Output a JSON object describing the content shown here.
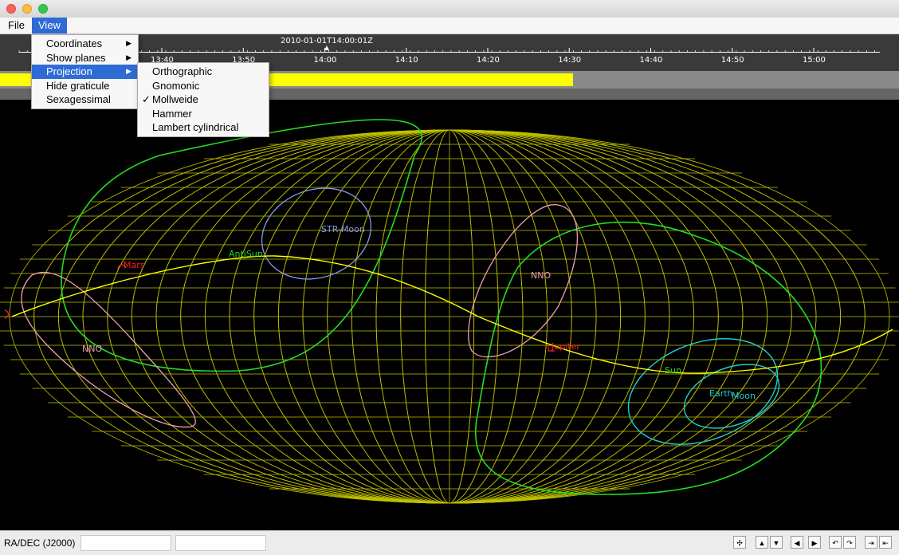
{
  "menu": {
    "file_label": "File",
    "view_label": "View"
  },
  "view_menu": {
    "items": [
      {
        "label": "Coordinates",
        "submenu": true
      },
      {
        "label": "Show planes",
        "submenu": true
      },
      {
        "label": "Projection",
        "submenu": true,
        "highlighted": true
      },
      {
        "label": "Hide graticule",
        "submenu": false
      },
      {
        "label": "Sexagessimal",
        "submenu": false
      }
    ]
  },
  "projection_menu": {
    "items": [
      {
        "label": "Orthographic",
        "checked": false
      },
      {
        "label": "Gnomonic",
        "checked": false
      },
      {
        "label": "Mollweide",
        "checked": true
      },
      {
        "label": "Hammer",
        "checked": false
      },
      {
        "label": "Lambert cylindrical",
        "checked": false
      }
    ],
    "check_mark": "✓"
  },
  "timeline": {
    "current_time": "2010-01-01T14:00:01Z",
    "ticks": [
      "13:40",
      "13:50",
      "14:00",
      "14:10",
      "14:20",
      "14:30",
      "14:40",
      "14:50",
      "15:00"
    ],
    "progress_fraction": 0.637
  },
  "sky_labels": {
    "str_moon": "STR-Moon",
    "antisun": "AntiSun",
    "mars": "Mars",
    "nno_left": "NNO",
    "nno_right": "NNO",
    "jupiter": "Jupiter",
    "sun": "Sun",
    "earth": "Earth",
    "moon": "Moon"
  },
  "status": {
    "coord_label": "RA/DEC (J2000)",
    "field1_value": "",
    "field2_value": ""
  },
  "nav_icons": [
    "move-icon",
    "up-icon",
    "down-icon",
    "left-icon",
    "right-icon",
    "rotate-left-icon",
    "rotate-right-icon",
    "zoom-in-icon",
    "zoom-out-icon"
  ],
  "colors": {
    "graticule": "#c0c000",
    "ecliptic": "#ffff00",
    "green_plane": "#22dd22",
    "pink_plane": "#e8a0b0",
    "blue_plane": "#8899ee",
    "cyan_plane": "#22cccc",
    "mars": "#ff2020",
    "jupiter": "#ff2020",
    "highlight": "#2e6bd4"
  }
}
